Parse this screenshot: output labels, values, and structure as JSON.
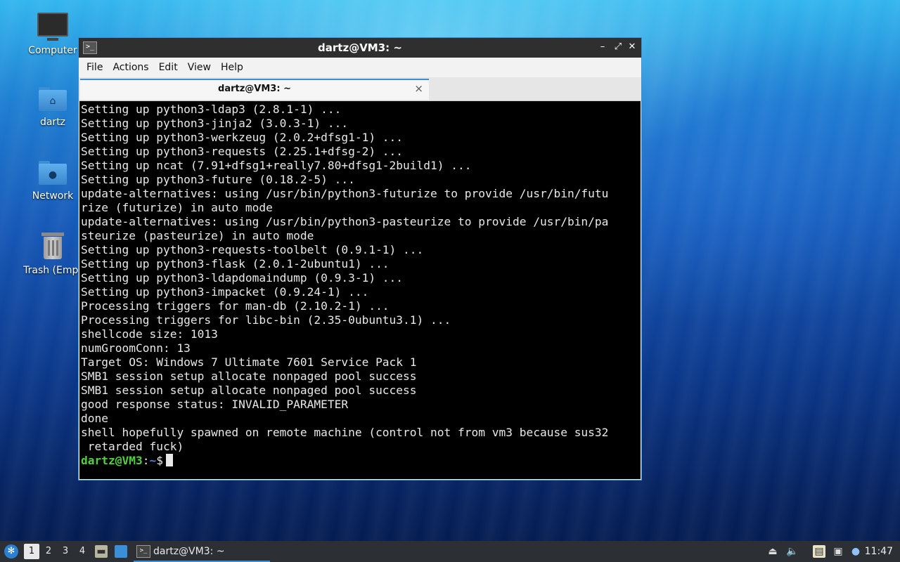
{
  "desktop": {
    "icons": [
      {
        "label": "Computer",
        "icon": "computer-icon"
      },
      {
        "label": "dartz",
        "icon": "home-folder-icon"
      },
      {
        "label": "Network",
        "icon": "network-folder-icon"
      },
      {
        "label": "Trash (Empt",
        "icon": "trash-icon"
      }
    ]
  },
  "window": {
    "title": "dartz@VM3: ~",
    "app_icon_text": ">_",
    "controls": {
      "minimize": "–",
      "maximize": "⤢",
      "close": "✕"
    },
    "menu": [
      "File",
      "Actions",
      "Edit",
      "View",
      "Help"
    ],
    "tab": {
      "label": "dartz@VM3: ~",
      "close": "×"
    },
    "terminal": {
      "lines": [
        "Setting up python3-ldap3 (2.8.1-1) ...",
        "Setting up python3-jinja2 (3.0.3-1) ...",
        "Setting up python3-werkzeug (2.0.2+dfsg1-1) ...",
        "Setting up python3-requests (2.25.1+dfsg-2) ...",
        "Setting up ncat (7.91+dfsg1+really7.80+dfsg1-2build1) ...",
        "Setting up python3-future (0.18.2-5) ...",
        "update-alternatives: using /usr/bin/python3-futurize to provide /usr/bin/futu",
        "rize (futurize) in auto mode",
        "update-alternatives: using /usr/bin/python3-pasteurize to provide /usr/bin/pa",
        "steurize (pasteurize) in auto mode",
        "Setting up python3-requests-toolbelt (0.9.1-1) ...",
        "Setting up python3-flask (2.0.1-2ubuntu1) ...",
        "Setting up python3-ldapdomaindump (0.9.3-1) ...",
        "Setting up python3-impacket (0.9.24-1) ...",
        "Processing triggers for man-db (2.10.2-1) ...",
        "Processing triggers for libc-bin (2.35-0ubuntu3.1) ...",
        "shellcode size: 1013",
        "numGroomConn: 13",
        "Target OS: Windows 7 Ultimate 7601 Service Pack 1",
        "SMB1 session setup allocate nonpaged pool success",
        "SMB1 session setup allocate nonpaged pool success",
        "good response status: INVALID_PARAMETER",
        "done",
        "shell hopefully spawned on remote machine (control not from vm3 because sus32",
        " retarded fuck)"
      ],
      "prompt": {
        "user_host": "dartz@VM3",
        "colon": ":",
        "path": "~",
        "symbol": "$"
      }
    }
  },
  "taskbar": {
    "workspaces": [
      "1",
      "2",
      "3",
      "4"
    ],
    "active_workspace": "1",
    "task_label": "dartz@VM3: ~",
    "task_icon_text": ">_",
    "clock": "11:47",
    "tray_icons": [
      "eject-icon",
      "volume-icon",
      "clipboard-icon",
      "network-icon",
      "updates-icon"
    ]
  },
  "colors": {
    "prompt_user": "#4fd13a",
    "prompt_path": "#4f7fe0",
    "accent": "#3a8fd8",
    "titlebar": "#2f2f2f",
    "terminal_bg": "#000000"
  }
}
